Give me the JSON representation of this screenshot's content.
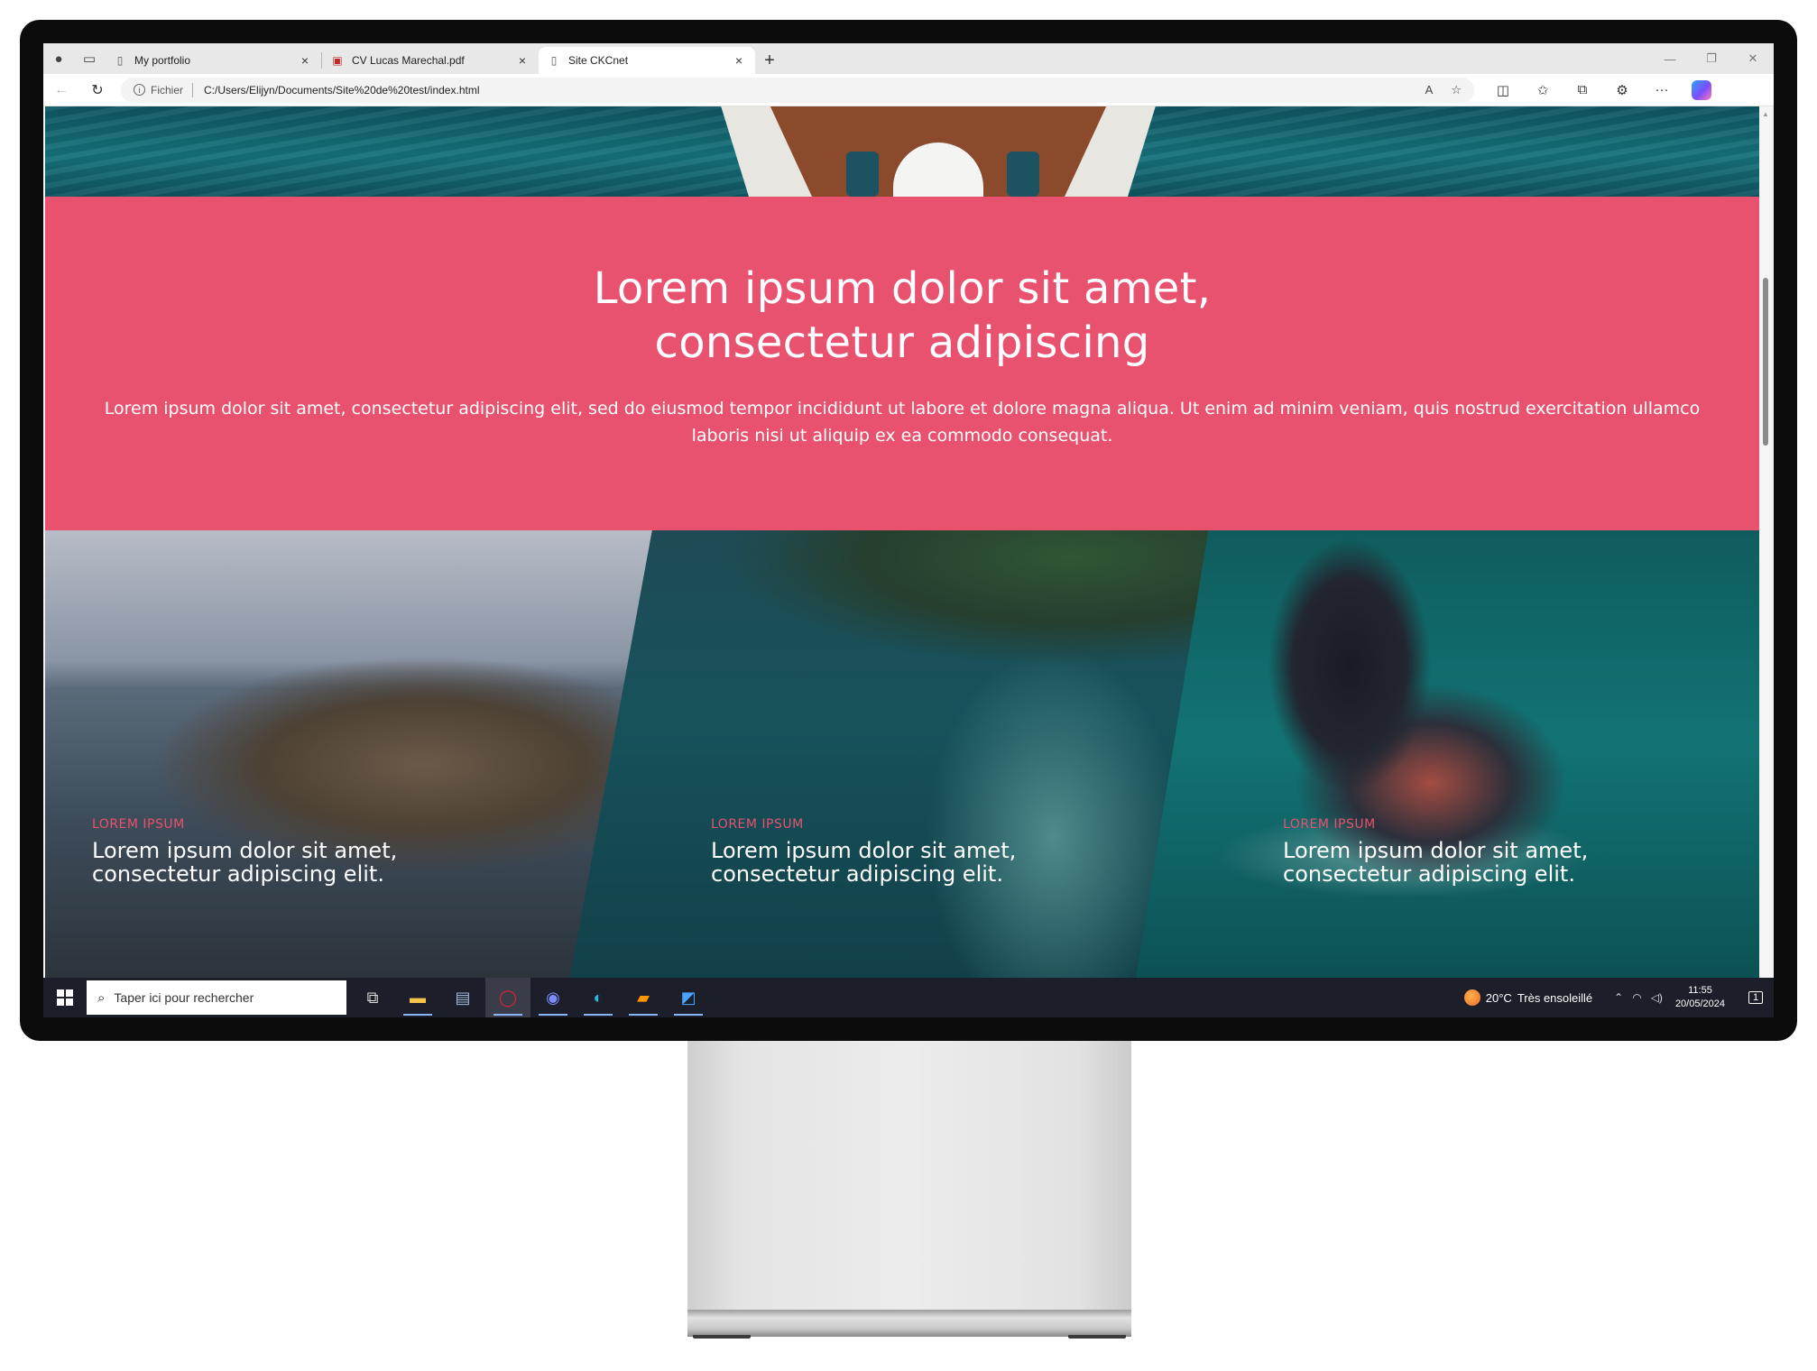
{
  "browser": {
    "tabs": [
      {
        "title": "My portfolio",
        "icon": "page-icon",
        "active": false
      },
      {
        "title": "CV Lucas Marechal.pdf",
        "icon": "pdf-icon",
        "active": false
      },
      {
        "title": "Site CKCnet",
        "icon": "page-icon",
        "active": true
      }
    ],
    "new_tab_glyph": "+",
    "address": {
      "scheme_label": "Fichier",
      "url": "C:/Users/Elijyn/Documents/Site%20de%20test/index.html"
    }
  },
  "page": {
    "band": {
      "title_line1": "Lorem ipsum dolor sit amet,",
      "title_line2": "consectetur adipiscing",
      "body": "Lorem ipsum dolor sit amet, consectetur adipiscing elit, sed do eiusmod tempor incididunt ut labore et dolore magna aliqua. Ut enim ad minim veniam, quis nostrud exercitation ullamco laboris nisi ut aliquip ex ea commodo consequat.",
      "background": "#e8526e"
    },
    "cards": [
      {
        "kicker": "LOREM IPSUM",
        "title": "Lorem ipsum dolor sit amet, consectetur adipiscing elit."
      },
      {
        "kicker": "LOREM IPSUM",
        "title": "Lorem ipsum dolor sit amet, consectetur adipiscing elit."
      },
      {
        "kicker": "LOREM IPSUM",
        "title": "Lorem ipsum dolor sit amet, consectetur adipiscing elit."
      }
    ]
  },
  "taskbar": {
    "search_placeholder": "Taper ici pour rechercher",
    "weather": {
      "temp": "20°C",
      "condition": "Très ensoleillé"
    },
    "clock": {
      "time": "11:55",
      "date": "20/05/2024"
    },
    "notification_count": "1",
    "apps": [
      "task-view-icon",
      "file-explorer-icon",
      "photos-icon",
      "opera-icon",
      "discord-icon",
      "edge-icon",
      "sublime-text-icon",
      "paint-icon"
    ]
  }
}
